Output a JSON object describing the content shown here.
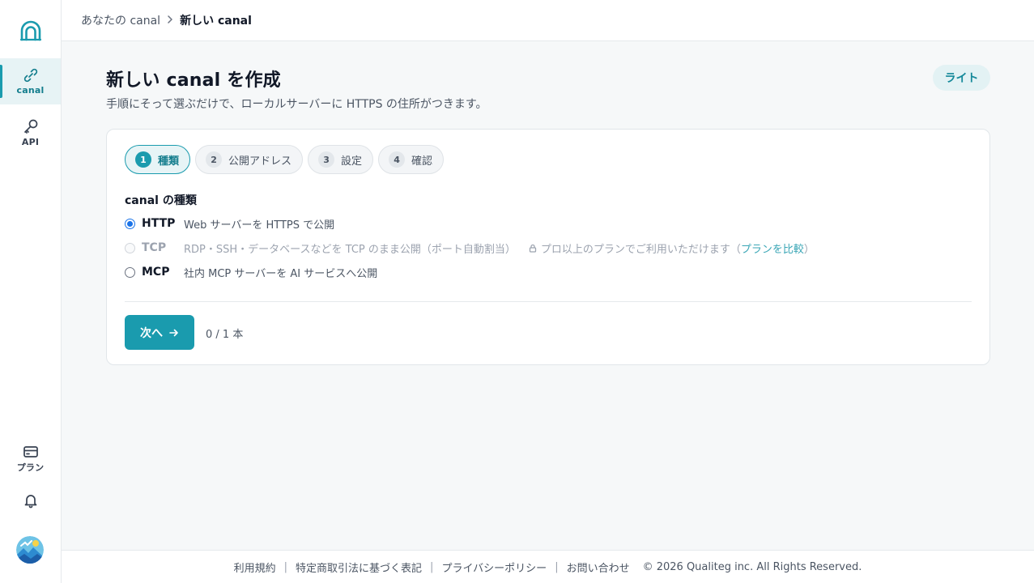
{
  "colors": {
    "accent": "#1a9bae",
    "radio": "#1a73e8"
  },
  "sidebar": {
    "items": [
      {
        "label": "canal",
        "icon": "link-icon",
        "active": true
      },
      {
        "label": "API",
        "icon": "key-icon"
      },
      {
        "label": "プラン",
        "icon": "credit-card-icon"
      },
      {
        "icon": "bell-icon"
      }
    ]
  },
  "breadcrumb": {
    "parent": "あなたの canal",
    "current": "新しい canal"
  },
  "page": {
    "title": "新しい canal を作成",
    "subtitle": "手順にそって選ぶだけで、ローカルサーバーに HTTPS の住所がつきます。",
    "mode_badge": "ライト"
  },
  "steps": [
    {
      "num": "1",
      "label": "種類",
      "active": true
    },
    {
      "num": "2",
      "label": "公開アドレス"
    },
    {
      "num": "3",
      "label": "設定"
    },
    {
      "num": "4",
      "label": "確認"
    }
  ],
  "canal_type": {
    "label": "canal の種類",
    "options": [
      {
        "name": "HTTP",
        "desc": "Web サーバーを HTTPS で公開",
        "selected": true
      },
      {
        "name": "TCP",
        "desc": "RDP・SSH・データベースなどを TCP のまま公開（ポート自動割当）",
        "disabled": true,
        "lock_note": "プロ以上のプランでご利用いただけます（",
        "lock_link": "プランを比較",
        "lock_close": "）"
      },
      {
        "name": "MCP",
        "desc": "社内 MCP サーバーを AI サービスへ公開"
      }
    ]
  },
  "actions": {
    "next_label": "次へ",
    "count": "0 / 1 本"
  },
  "footer": {
    "links": [
      "利用規約",
      "特定商取引法に基づく表記",
      "プライバシーポリシー",
      "お問い合わせ"
    ],
    "copyright": "© 2026 Qualiteg inc. All Rights Reserved."
  }
}
